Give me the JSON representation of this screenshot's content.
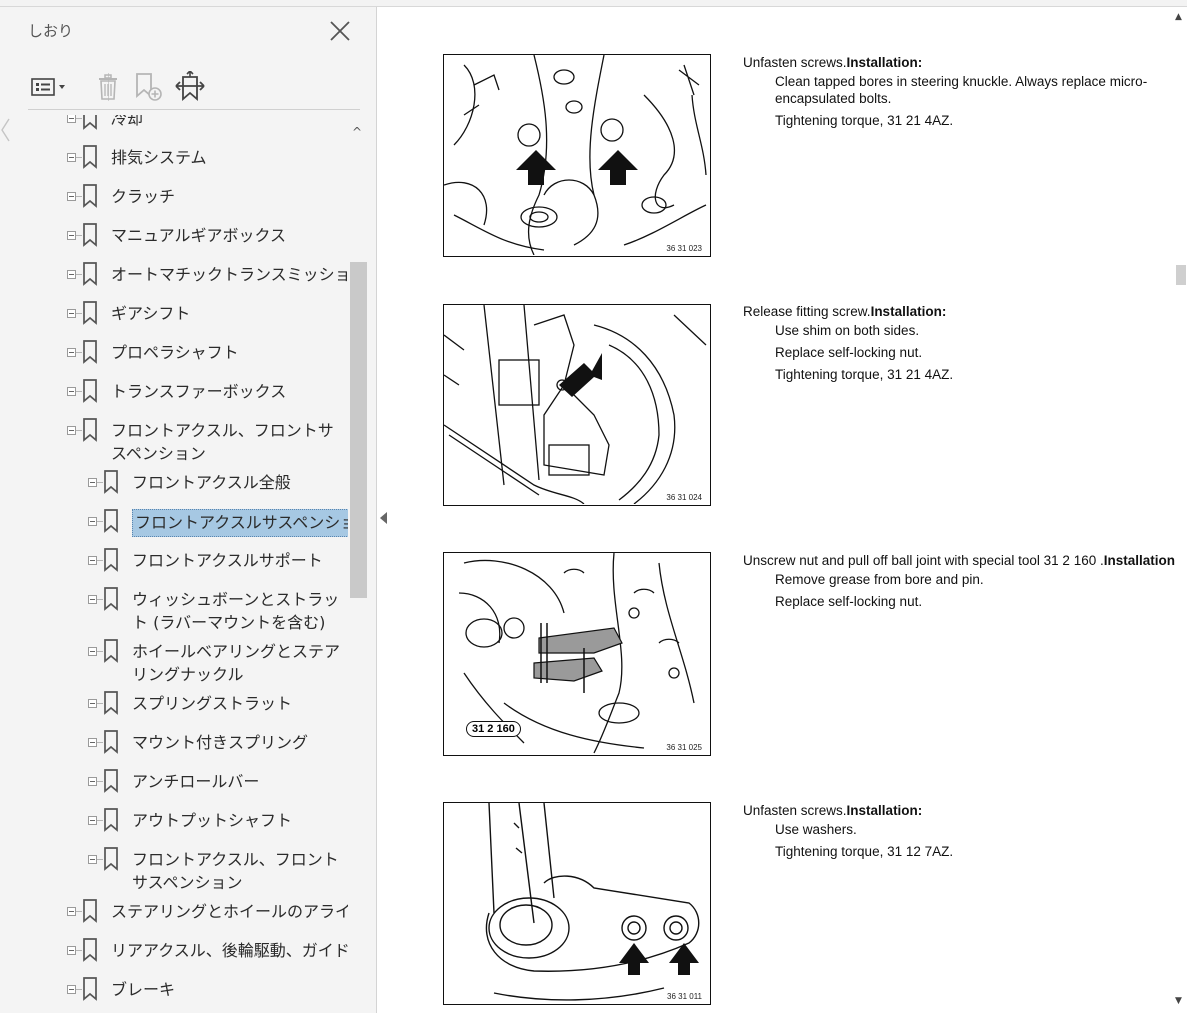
{
  "sidebar": {
    "title": "しおり",
    "toolbar": {
      "options_icon": "list-options-icon",
      "delete_icon": "trash-icon",
      "new_bookmark_icon": "new-bookmark-icon",
      "expand_icon": "expand-bookmark-icon"
    },
    "items": [
      {
        "label": "冷却",
        "level": 0
      },
      {
        "label": "排気システム",
        "level": 0
      },
      {
        "label": "クラッチ",
        "level": 0
      },
      {
        "label": "マニュアルギアボックス",
        "level": 0
      },
      {
        "label": "オートマチックトランスミッション",
        "level": 0
      },
      {
        "label": "ギアシフト",
        "level": 0
      },
      {
        "label": "プロペラシャフト",
        "level": 0
      },
      {
        "label": "トランスファーボックス",
        "level": 0
      },
      {
        "label": "フロントアクスル、フロントサスペンション",
        "level": 0
      },
      {
        "label": "フロントアクスル全般",
        "level": 1
      },
      {
        "label": "フロントアクスルサスペンション",
        "level": 1,
        "selected": true
      },
      {
        "label": "フロントアクスルサポート",
        "level": 1
      },
      {
        "label": "ウィッシュボーンとストラット (ラバーマウントを含む)",
        "level": 1
      },
      {
        "label": "ホイールベアリングとステアリングナックル",
        "level": 1
      },
      {
        "label": "スプリングストラット",
        "level": 1
      },
      {
        "label": "マウント付きスプリング",
        "level": 1
      },
      {
        "label": "アンチロールバー",
        "level": 1
      },
      {
        "label": "アウトプットシャフト",
        "level": 1
      },
      {
        "label": "フロントアクスル、フロントサスペンション",
        "level": 1
      },
      {
        "label": "ステアリングとホイールのアライメント",
        "level": 0
      },
      {
        "label": "リアアクスル、後輪駆動、ガイド",
        "level": 0
      },
      {
        "label": "ブレーキ",
        "level": 0
      }
    ]
  },
  "document": {
    "steps": [
      {
        "figure_code": "36 31 023",
        "action": "Unfasten screws.",
        "installation": "Installation:",
        "lines": [
          "Clean tapped bores in steering knuckle. Always replace micro-encapsulated bolts.",
          "Tightening torque, 31 21 4AZ."
        ]
      },
      {
        "figure_code": "36 31 024",
        "action": "Release fitting screw.",
        "installation": "Installation:",
        "lines": [
          "Use shim on both sides.",
          "Replace self-locking nut.",
          "Tightening torque, 31 21 4AZ."
        ]
      },
      {
        "figure_code": "36 31 025",
        "tool_label": "31 2 160",
        "action": "Unscrew nut and pull off ball joint with special tool 31 2 160 .",
        "installation": "Installation:",
        "lines": [
          "Remove grease from bore and pin.",
          "Replace self-locking nut."
        ]
      },
      {
        "figure_code": "36 31 011",
        "action": "Unfasten screws.",
        "installation": "Installation:",
        "lines": [
          "Use washers.",
          "Tightening torque, 31 12 7AZ."
        ]
      }
    ]
  },
  "colors": {
    "selection": "#a6c8e3",
    "sidebar_bg": "#f4f4f4",
    "scroll_thumb": "#c9c9c9"
  }
}
